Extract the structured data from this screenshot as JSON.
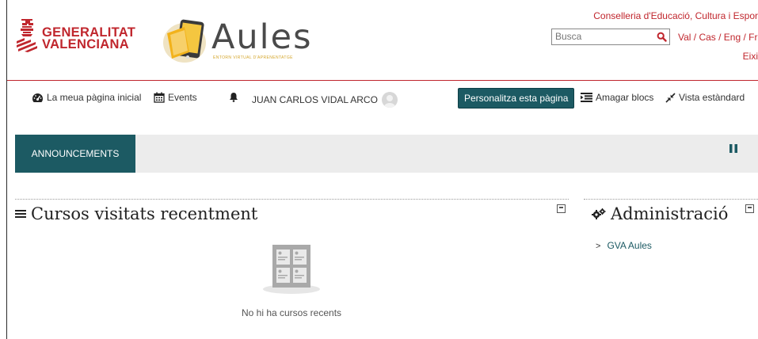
{
  "header": {
    "gva_line1": "GENERALITAT",
    "gva_line2": "VALENCIANA",
    "aules_title": "Aules",
    "aules_tagline": "ENTORN VIRTUAL D'APRENENTATGE",
    "conselleria": "Conselleria d'Educació, Cultura i Espor",
    "search_placeholder": "Busca",
    "languages": "Val / Cas / Eng / Fra",
    "logout": "Eixi",
    "brand_color": "#c0262d"
  },
  "navbar": {
    "home": "La meua pàgina inicial",
    "events": "Events",
    "user_name": "JUAN CARLOS VIDAL ARCO",
    "customise": "Personalitza esta pàgina",
    "hide_blocks": "Amagar blocs",
    "standard_view": "Vista estàndard",
    "accent_color": "#1c5a63"
  },
  "announcements": {
    "tab_label": "ANNOUNCEMENTS"
  },
  "recent_courses": {
    "title": "Cursos visitats recentment",
    "empty_text": "No hi ha cursos recents"
  },
  "administration": {
    "title": "Administració",
    "items": [
      "GVA Aules"
    ]
  }
}
